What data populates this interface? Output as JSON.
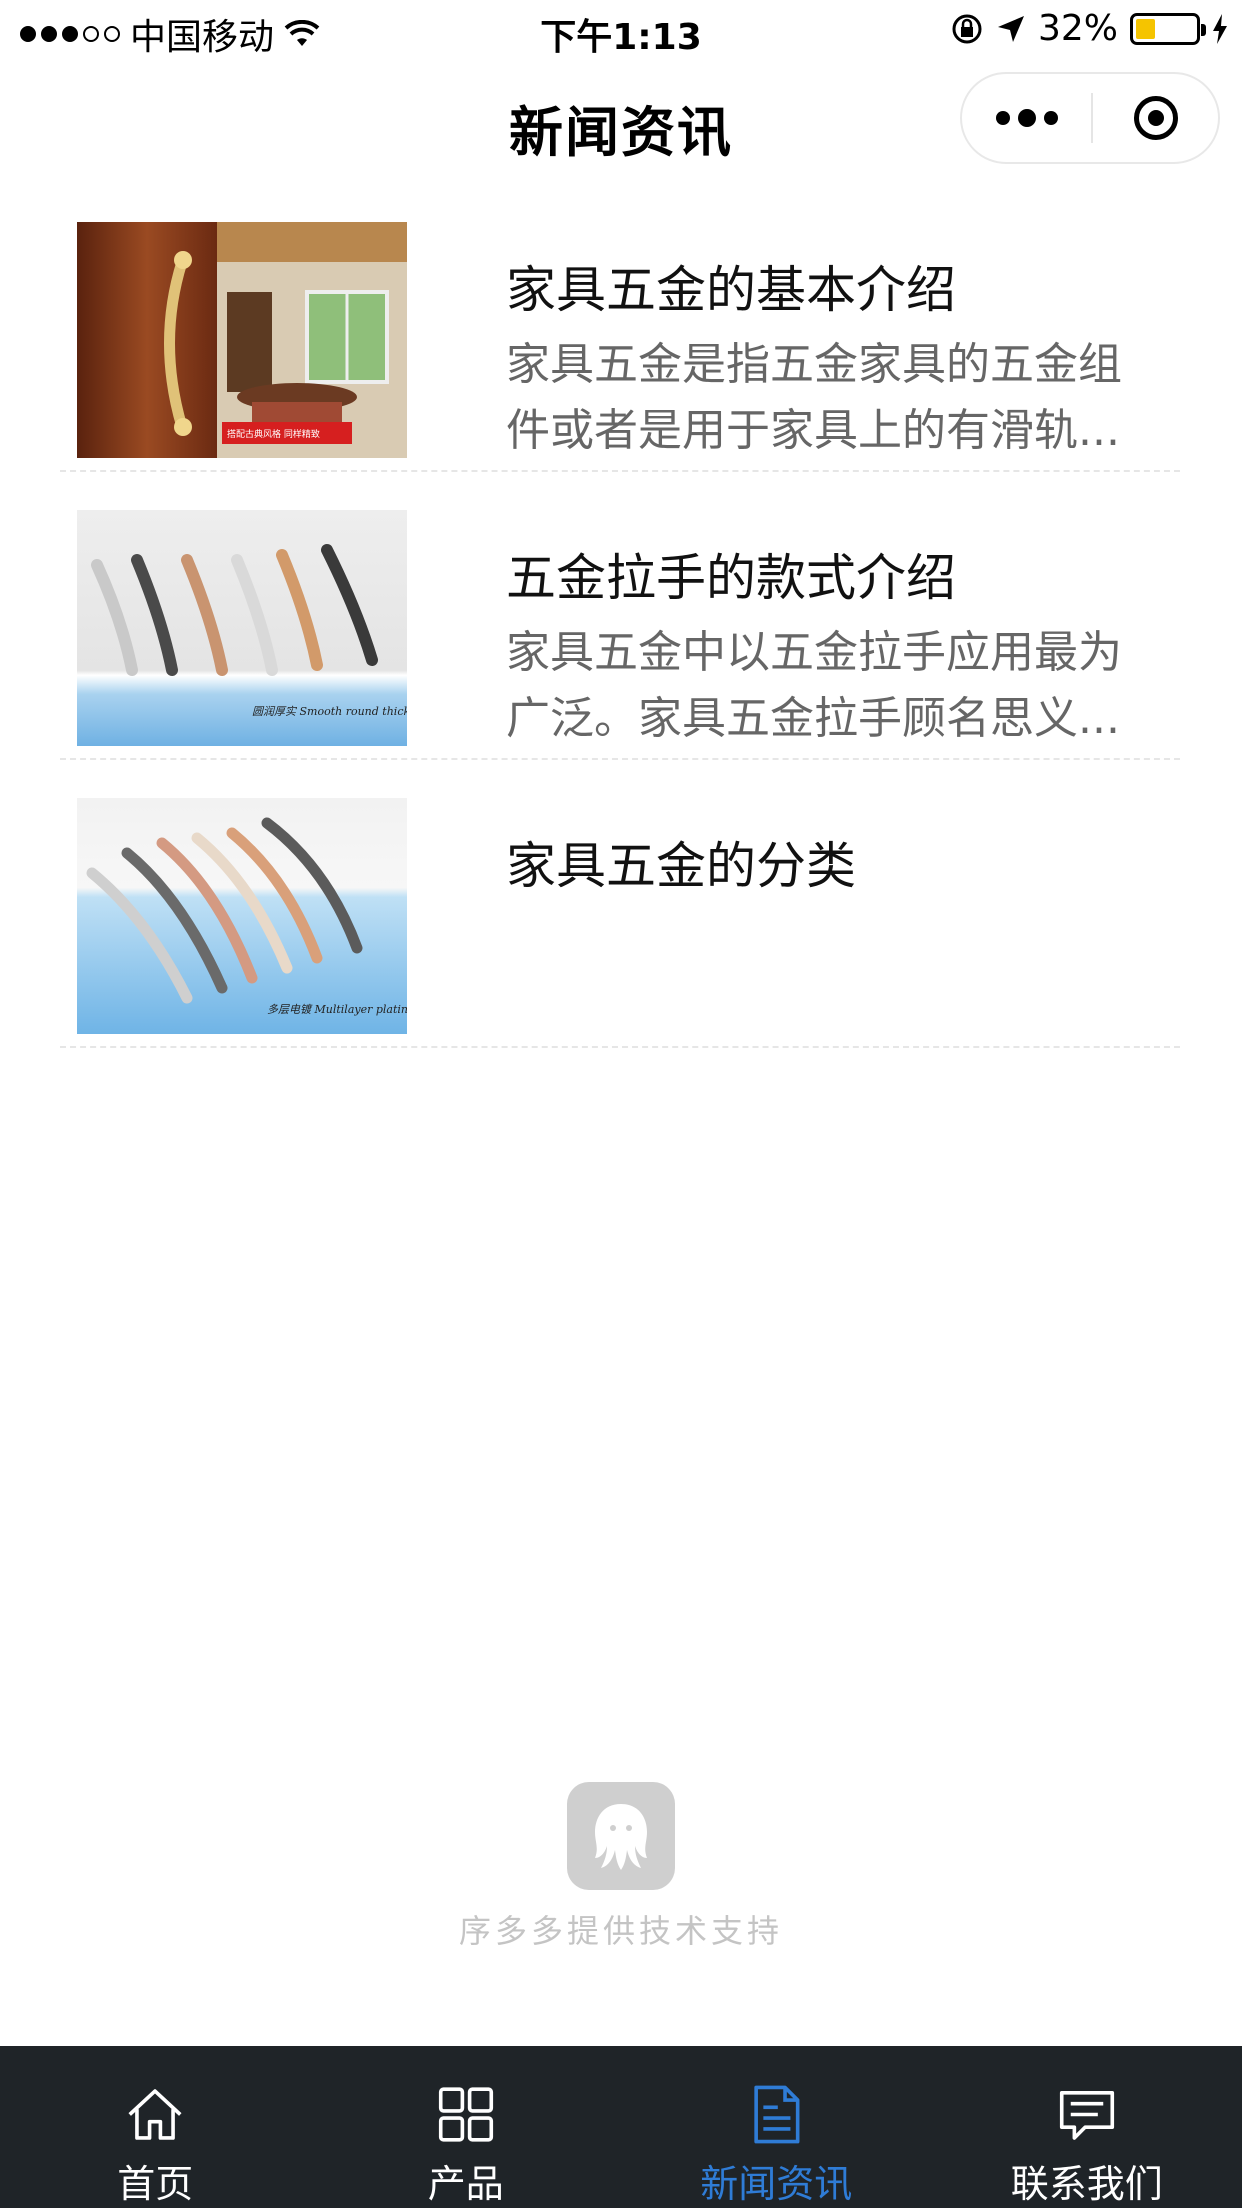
{
  "status_bar": {
    "carrier": "中国移动",
    "time": "下午1:13",
    "battery_percent": "32%",
    "battery_level": 0.32,
    "signal_strength": 3,
    "battery_color": "#f5c400"
  },
  "header": {
    "title": "新闻资讯",
    "more_icon": "more-dots-icon",
    "close_icon": "target-icon"
  },
  "news": [
    {
      "title": "家具五金的基本介绍",
      "description": "家具五金是指五金家具的五金组件或者是用于家具上的有滑轨...",
      "image_caption": "搭配古典风格 同样精致"
    },
    {
      "title": "五金拉手的款式介绍",
      "description": "家具五金中以五金拉手应用最为广泛。家具五金拉手顾名思义...",
      "image_caption": "圆润厚实 Smooth round thick"
    },
    {
      "title": "家具五金的分类",
      "description": "",
      "image_caption": "多层电镀 Multilayer plating"
    }
  ],
  "footer": {
    "support_text": "序多多提供技术支持"
  },
  "tab_bar": {
    "active_color": "#2f7cd6",
    "items": [
      {
        "label": "首页",
        "icon": "home-icon"
      },
      {
        "label": "产品",
        "icon": "grid-icon"
      },
      {
        "label": "新闻资讯",
        "icon": "document-icon"
      },
      {
        "label": "联系我们",
        "icon": "chat-icon"
      }
    ]
  }
}
